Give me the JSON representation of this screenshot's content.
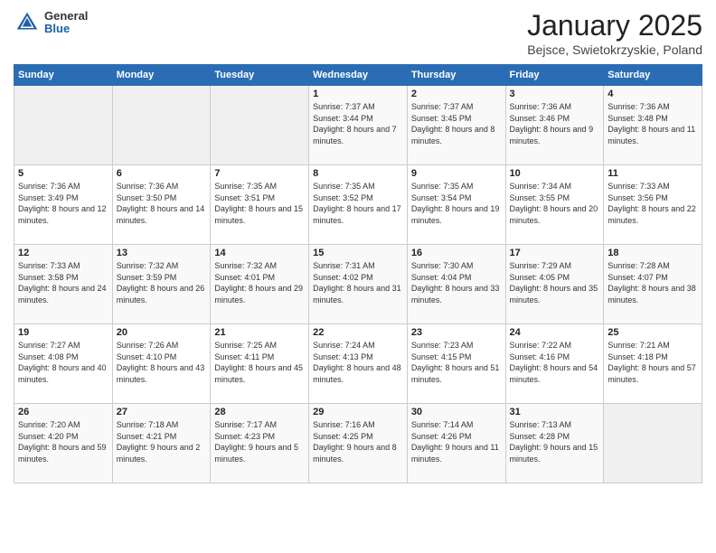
{
  "header": {
    "logo_general": "General",
    "logo_blue": "Blue",
    "month_title": "January 2025",
    "subtitle": "Bejsce, Swietokrzyskie, Poland"
  },
  "weekdays": [
    "Sunday",
    "Monday",
    "Tuesday",
    "Wednesday",
    "Thursday",
    "Friday",
    "Saturday"
  ],
  "weeks": [
    [
      {
        "day": "",
        "info": ""
      },
      {
        "day": "",
        "info": ""
      },
      {
        "day": "",
        "info": ""
      },
      {
        "day": "1",
        "info": "Sunrise: 7:37 AM\nSunset: 3:44 PM\nDaylight: 8 hours\nand 7 minutes."
      },
      {
        "day": "2",
        "info": "Sunrise: 7:37 AM\nSunset: 3:45 PM\nDaylight: 8 hours\nand 8 minutes."
      },
      {
        "day": "3",
        "info": "Sunrise: 7:36 AM\nSunset: 3:46 PM\nDaylight: 8 hours\nand 9 minutes."
      },
      {
        "day": "4",
        "info": "Sunrise: 7:36 AM\nSunset: 3:48 PM\nDaylight: 8 hours\nand 11 minutes."
      }
    ],
    [
      {
        "day": "5",
        "info": "Sunrise: 7:36 AM\nSunset: 3:49 PM\nDaylight: 8 hours\nand 12 minutes."
      },
      {
        "day": "6",
        "info": "Sunrise: 7:36 AM\nSunset: 3:50 PM\nDaylight: 8 hours\nand 14 minutes."
      },
      {
        "day": "7",
        "info": "Sunrise: 7:35 AM\nSunset: 3:51 PM\nDaylight: 8 hours\nand 15 minutes."
      },
      {
        "day": "8",
        "info": "Sunrise: 7:35 AM\nSunset: 3:52 PM\nDaylight: 8 hours\nand 17 minutes."
      },
      {
        "day": "9",
        "info": "Sunrise: 7:35 AM\nSunset: 3:54 PM\nDaylight: 8 hours\nand 19 minutes."
      },
      {
        "day": "10",
        "info": "Sunrise: 7:34 AM\nSunset: 3:55 PM\nDaylight: 8 hours\nand 20 minutes."
      },
      {
        "day": "11",
        "info": "Sunrise: 7:33 AM\nSunset: 3:56 PM\nDaylight: 8 hours\nand 22 minutes."
      }
    ],
    [
      {
        "day": "12",
        "info": "Sunrise: 7:33 AM\nSunset: 3:58 PM\nDaylight: 8 hours\nand 24 minutes."
      },
      {
        "day": "13",
        "info": "Sunrise: 7:32 AM\nSunset: 3:59 PM\nDaylight: 8 hours\nand 26 minutes."
      },
      {
        "day": "14",
        "info": "Sunrise: 7:32 AM\nSunset: 4:01 PM\nDaylight: 8 hours\nand 29 minutes."
      },
      {
        "day": "15",
        "info": "Sunrise: 7:31 AM\nSunset: 4:02 PM\nDaylight: 8 hours\nand 31 minutes."
      },
      {
        "day": "16",
        "info": "Sunrise: 7:30 AM\nSunset: 4:04 PM\nDaylight: 8 hours\nand 33 minutes."
      },
      {
        "day": "17",
        "info": "Sunrise: 7:29 AM\nSunset: 4:05 PM\nDaylight: 8 hours\nand 35 minutes."
      },
      {
        "day": "18",
        "info": "Sunrise: 7:28 AM\nSunset: 4:07 PM\nDaylight: 8 hours\nand 38 minutes."
      }
    ],
    [
      {
        "day": "19",
        "info": "Sunrise: 7:27 AM\nSunset: 4:08 PM\nDaylight: 8 hours\nand 40 minutes."
      },
      {
        "day": "20",
        "info": "Sunrise: 7:26 AM\nSunset: 4:10 PM\nDaylight: 8 hours\nand 43 minutes."
      },
      {
        "day": "21",
        "info": "Sunrise: 7:25 AM\nSunset: 4:11 PM\nDaylight: 8 hours\nand 45 minutes."
      },
      {
        "day": "22",
        "info": "Sunrise: 7:24 AM\nSunset: 4:13 PM\nDaylight: 8 hours\nand 48 minutes."
      },
      {
        "day": "23",
        "info": "Sunrise: 7:23 AM\nSunset: 4:15 PM\nDaylight: 8 hours\nand 51 minutes."
      },
      {
        "day": "24",
        "info": "Sunrise: 7:22 AM\nSunset: 4:16 PM\nDaylight: 8 hours\nand 54 minutes."
      },
      {
        "day": "25",
        "info": "Sunrise: 7:21 AM\nSunset: 4:18 PM\nDaylight: 8 hours\nand 57 minutes."
      }
    ],
    [
      {
        "day": "26",
        "info": "Sunrise: 7:20 AM\nSunset: 4:20 PM\nDaylight: 8 hours\nand 59 minutes."
      },
      {
        "day": "27",
        "info": "Sunrise: 7:18 AM\nSunset: 4:21 PM\nDaylight: 9 hours\nand 2 minutes."
      },
      {
        "day": "28",
        "info": "Sunrise: 7:17 AM\nSunset: 4:23 PM\nDaylight: 9 hours\nand 5 minutes."
      },
      {
        "day": "29",
        "info": "Sunrise: 7:16 AM\nSunset: 4:25 PM\nDaylight: 9 hours\nand 8 minutes."
      },
      {
        "day": "30",
        "info": "Sunrise: 7:14 AM\nSunset: 4:26 PM\nDaylight: 9 hours\nand 11 minutes."
      },
      {
        "day": "31",
        "info": "Sunrise: 7:13 AM\nSunset: 4:28 PM\nDaylight: 9 hours\nand 15 minutes."
      },
      {
        "day": "",
        "info": ""
      }
    ]
  ]
}
